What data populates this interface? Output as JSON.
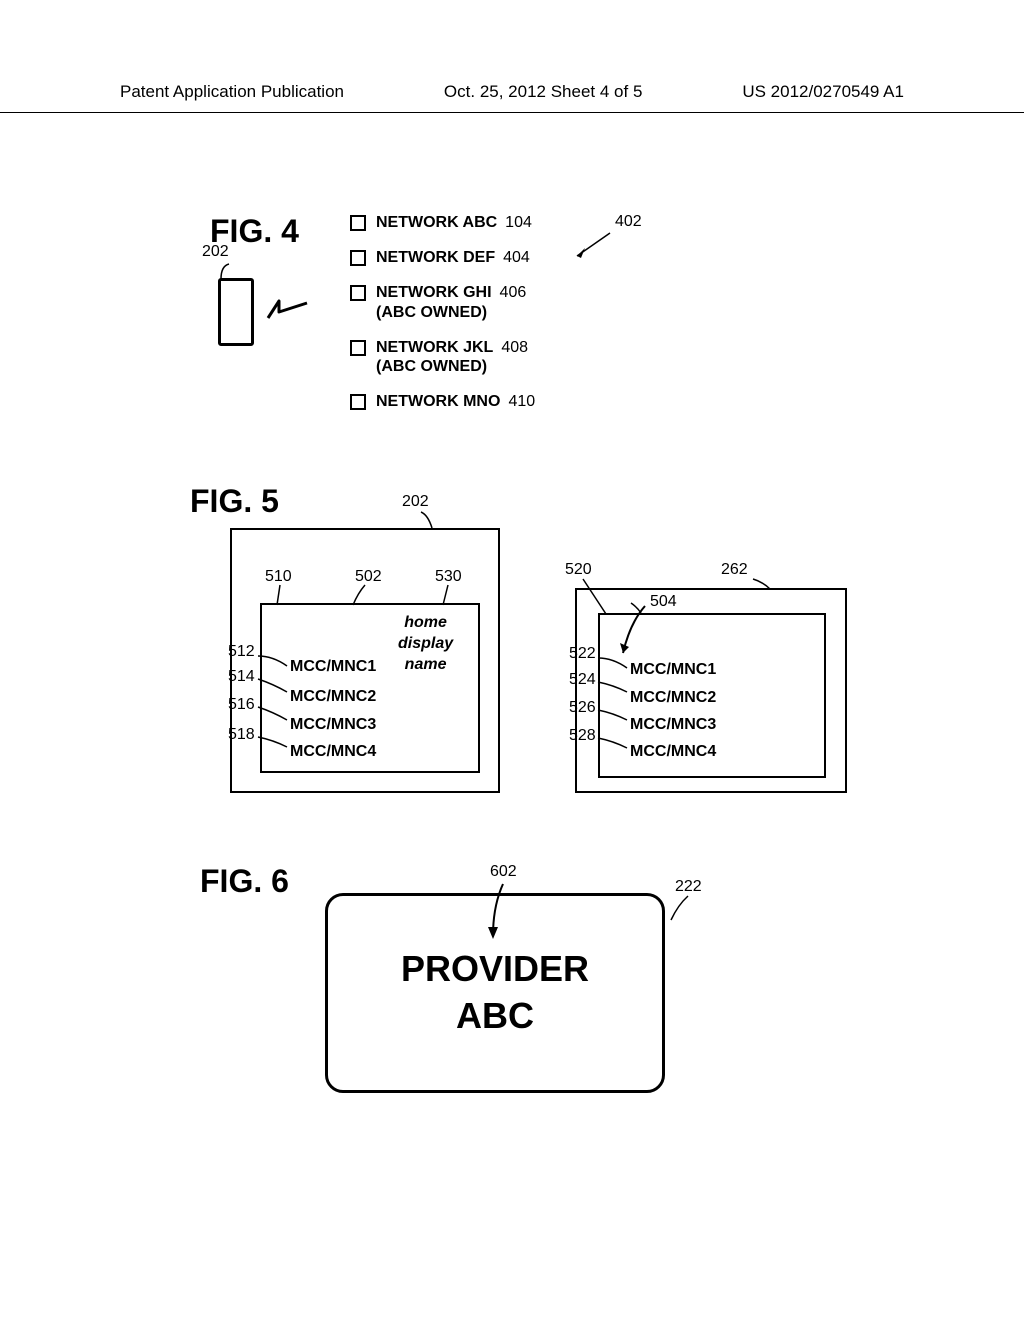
{
  "header": {
    "left": "Patent Application Publication",
    "center": "Oct. 25, 2012  Sheet 4 of 5",
    "right": "US 2012/0270549 A1"
  },
  "fig4": {
    "label": "FIG. 4",
    "ref_202": "202",
    "ref_402": "402",
    "networks": [
      {
        "label": "NETWORK ABC",
        "sub": "",
        "ref": "104"
      },
      {
        "label": "NETWORK DEF",
        "sub": "",
        "ref": "404"
      },
      {
        "label": "NETWORK GHI",
        "sub": "(ABC OWNED)",
        "ref": "406"
      },
      {
        "label": "NETWORK JKL",
        "sub": "(ABC OWNED)",
        "ref": "408"
      },
      {
        "label": "NETWORK MNO",
        "sub": "",
        "ref": "410"
      }
    ]
  },
  "fig5": {
    "label": "FIG. 5",
    "ref_202": "202",
    "ref_510": "510",
    "ref_502": "502",
    "ref_530": "530",
    "home_display_name_1": "home",
    "home_display_name_2": "display",
    "home_display_name_3": "name",
    "ref_512": "512",
    "ref_514": "514",
    "ref_516": "516",
    "ref_518": "518",
    "left_items": [
      "MCC/MNC1",
      "MCC/MNC2",
      "MCC/MNC3",
      "MCC/MNC4"
    ],
    "ref_520": "520",
    "ref_262": "262",
    "ref_504": "504",
    "ref_522": "522",
    "ref_524": "524",
    "ref_526": "526",
    "ref_528": "528",
    "right_items": [
      "MCC/MNC1",
      "MCC/MNC2",
      "MCC/MNC3",
      "MCC/MNC4"
    ]
  },
  "fig6": {
    "label": "FIG. 6",
    "ref_602": "602",
    "ref_222": "222",
    "provider_1": "PROVIDER",
    "provider_2": "ABC"
  }
}
